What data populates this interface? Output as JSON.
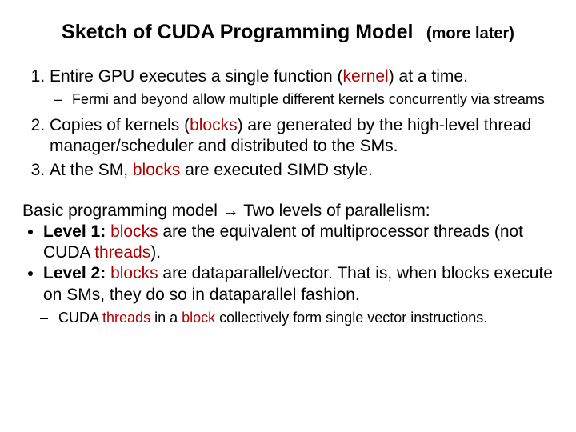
{
  "title": {
    "main": "Sketch of CUDA Programming Model",
    "sub": "(more later)"
  },
  "ol": {
    "i1_a": "Entire GPU executes a single function (",
    "i1_k": "kernel",
    "i1_b": ") at a time.",
    "i1_sub": "Fermi and beyond allow multiple different kernels concurrently via streams",
    "i2_a": "Copies of kernels (",
    "i2_k": "blocks",
    "i2_b": ") are generated by the high-level thread manager/scheduler and distributed to the SMs.",
    "i3_a": "At the SM, ",
    "i3_k": "blocks",
    "i3_b": " are executed SIMD style."
  },
  "p2": {
    "lead_a": "Basic programming model ",
    "arrow": "→",
    "lead_b": " Two levels of parallelism:",
    "l1_label": "Level 1:",
    "l1_a": "  ",
    "l1_k": "blocks",
    "l1_b": " are the equivalent of multiprocessor threads (not CUDA ",
    "l1_k2": "threads",
    "l1_c": ").",
    "l2_label": "Level 2:",
    "l2_a": "  ",
    "l2_k": "blocks",
    "l2_b": " are dataparallel/vector.  That is, when blocks execute on SMs, they do so in dataparallel fashion.",
    "sub_a": "CUDA ",
    "sub_k1": "threads",
    "sub_b": " in a ",
    "sub_k2": "block",
    "sub_c": " collectively form single vector instructions."
  }
}
